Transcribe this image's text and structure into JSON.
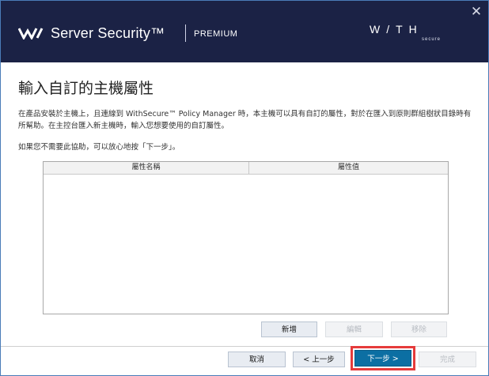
{
  "header": {
    "product_name": "Server Security™",
    "edition": "PREMIUM",
    "brand": "W/TH",
    "brand_sub": "secure",
    "close_glyph": "✕",
    "background": "#1b2245"
  },
  "page": {
    "title": "輸入自訂的主機屬性",
    "description": "在產品安裝於主機上，且連線到 WithSecure™ Policy Manager 時，本主機可以具有自訂的屬性，對於在匯入到原則群組樹狀目錄時有所幫助。在主控台匯入新主機時，輸入您想要使用的自訂屬性。",
    "hint": "如果您不需要此協助，可以放心地按「下一步」。"
  },
  "table": {
    "columns": [
      "屬性名稱",
      "屬性值"
    ],
    "rows": []
  },
  "actions": {
    "add": "新增",
    "edit": "編輯",
    "remove": "移除"
  },
  "footer": {
    "cancel": "取消",
    "back": "< 上一步",
    "next": "下一步 >",
    "finish": "完成",
    "primary_color": "#0c6fa3",
    "highlight_color": "#e53b3b"
  }
}
